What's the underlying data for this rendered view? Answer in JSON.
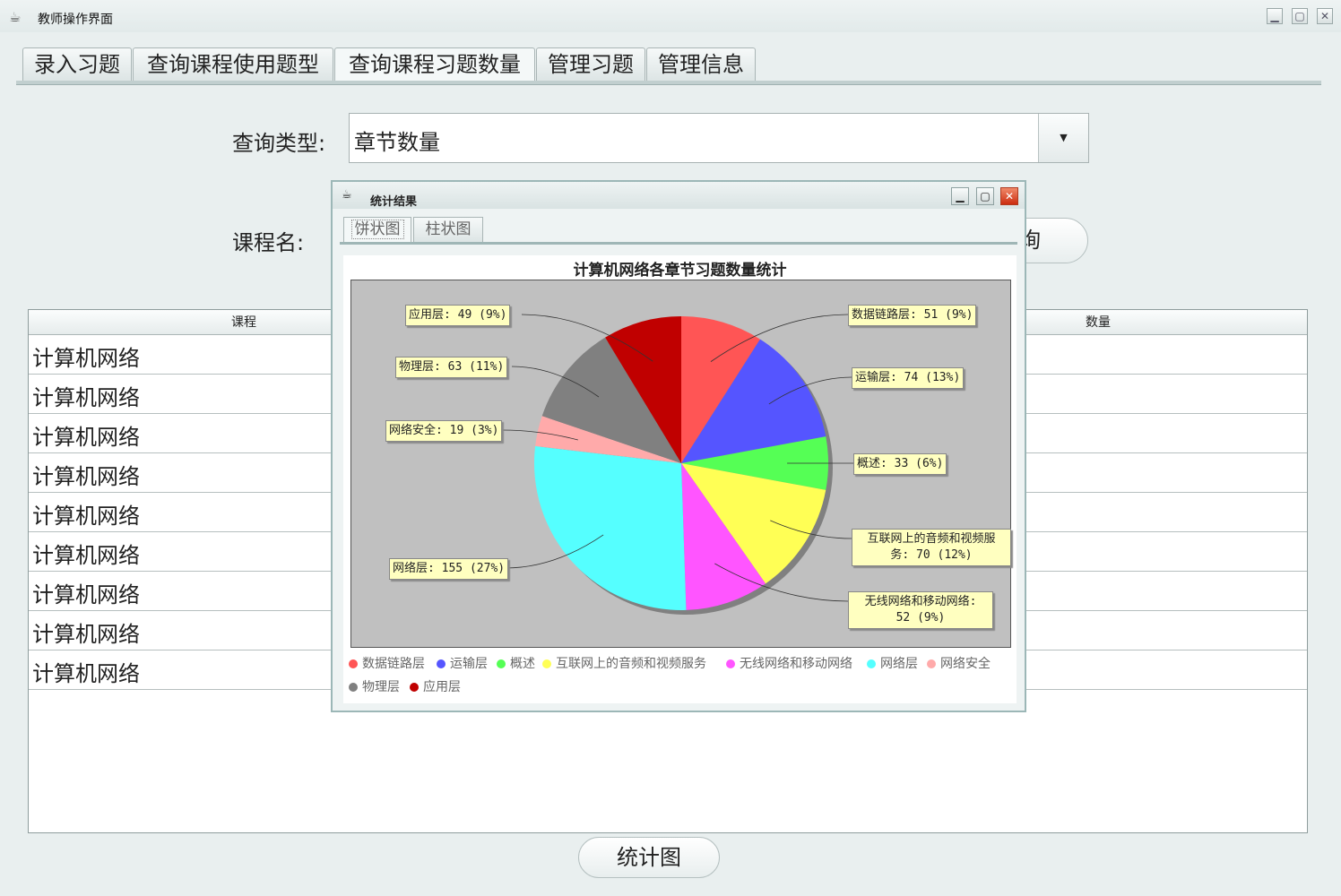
{
  "window": {
    "title": "教师操作界面",
    "app_icon": "cup-icon",
    "controls": {
      "minimize": "▁",
      "maximize": "▢",
      "close": "✕"
    }
  },
  "tabs": [
    {
      "label": "录入习题"
    },
    {
      "label": "查询课程使用题型"
    },
    {
      "label": "查询课程习题数量",
      "active": true
    },
    {
      "label": "管理习题"
    },
    {
      "label": "管理信息"
    }
  ],
  "form": {
    "query_type_label": "查询类型:",
    "query_type_value": "章节数量",
    "course_name_label": "课程名:",
    "query_button_partial": "询"
  },
  "table": {
    "columns": [
      "课程",
      "数量"
    ],
    "rows": [
      "计算机网络",
      "计算机网络",
      "计算机网络",
      "计算机网络",
      "计算机网络",
      "计算机网络",
      "计算机网络",
      "计算机网络",
      "计算机网络"
    ]
  },
  "stat_button": "统计图",
  "dialog": {
    "title": "统计结果",
    "tabs": [
      {
        "label": "饼状图",
        "active": true
      },
      {
        "label": "柱状图"
      }
    ],
    "controls": {
      "minimize": "▁",
      "maximize": "▢",
      "close": "✕"
    }
  },
  "chart_data": {
    "type": "pie",
    "title": "计算机网络各章节习题数量统计",
    "slices": [
      {
        "name": "数据链路层",
        "value": 51,
        "pct": "9%",
        "color": "#ff5555",
        "label": "数据链路层: 51 (9%)"
      },
      {
        "name": "运输层",
        "value": 74,
        "pct": "13%",
        "color": "#5555ff",
        "label": "运输层: 74 (13%)"
      },
      {
        "name": "概述",
        "value": 33,
        "pct": "6%",
        "color": "#55ff55",
        "label": "概述: 33 (6%)"
      },
      {
        "name": "互联网上的音频和视频服务",
        "value": 70,
        "pct": "12%",
        "color": "#ffff55",
        "label": "互联网上的音频和视频服务: 70 (12%)",
        "label_lines": [
          "互联网上的音频和视频服",
          "务: 70 (12%)"
        ]
      },
      {
        "name": "无线网络和移动网络",
        "value": 52,
        "pct": "9%",
        "color": "#ff55ff",
        "label": "无线网络和移动网络: 52 (9%)",
        "label_lines": [
          "无线网络和移动网络:",
          "52 (9%)"
        ]
      },
      {
        "name": "网络层",
        "value": 155,
        "pct": "27%",
        "color": "#55ffff",
        "label": "网络层: 155 (27%)"
      },
      {
        "name": "网络安全",
        "value": 19,
        "pct": "3%",
        "color": "#ffaaaa",
        "label": "网络安全: 19 (3%)"
      },
      {
        "name": "物理层",
        "value": 63,
        "pct": "11%",
        "color": "#808080",
        "label": "物理层: 63 (11%)"
      },
      {
        "name": "应用层",
        "value": 49,
        "pct": "9%",
        "color": "#c00000",
        "label": "应用层: 49 (9%)"
      }
    ],
    "legend": [
      "数据链路层",
      "运输层",
      "概述",
      "互联网上的音频和视频服务",
      "无线网络和移动网络",
      "网络层",
      "网络安全",
      "物理层",
      "应用层"
    ],
    "legend_position": "bottom"
  }
}
